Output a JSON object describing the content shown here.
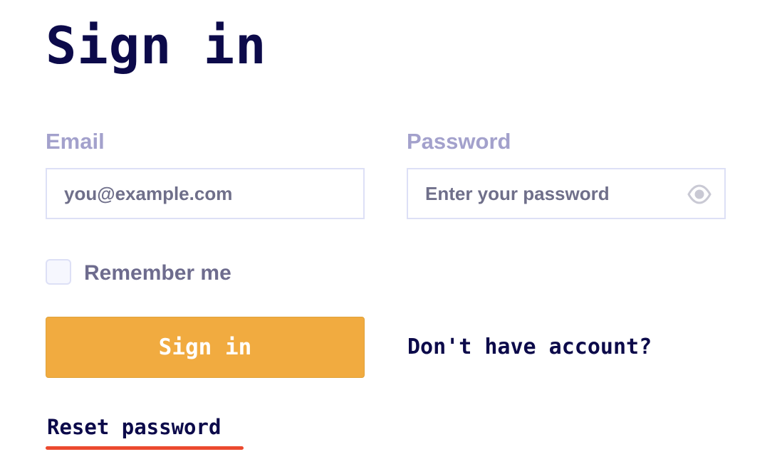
{
  "page": {
    "title": "Sign in"
  },
  "form": {
    "email": {
      "label": "Email",
      "placeholder": "you@example.com",
      "value": ""
    },
    "password": {
      "label": "Password",
      "placeholder": "Enter your password",
      "value": "",
      "toggle_icon": "eye-icon"
    },
    "remember": {
      "label": "Remember me",
      "checked": false
    },
    "submit_label": "Sign in"
  },
  "links": {
    "signup": "Don't have account?",
    "reset": "Reset password"
  },
  "colors": {
    "heading": "#0c0a4a",
    "label": "#a3a1cc",
    "button": "#f1ab40",
    "reset_underline": "#ec4a2f"
  }
}
